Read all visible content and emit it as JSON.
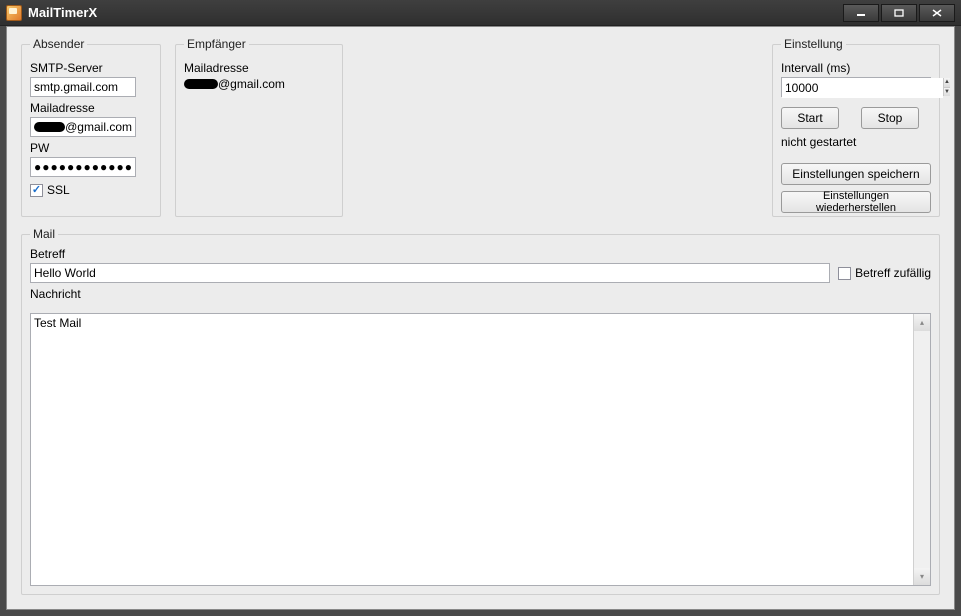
{
  "window": {
    "title": "MailTimerX"
  },
  "absender": {
    "legend": "Absender",
    "smtp_label": "SMTP-Server",
    "smtp_value": "smtp.gmail.com",
    "mail_label": "Mailadresse",
    "mail_suffix": "@gmail.com",
    "pw_label": "PW",
    "pw_value": "●●●●●●●●●●●●●",
    "ssl_label": "SSL",
    "ssl_checked": true
  },
  "empfaenger": {
    "legend": "Empfänger",
    "mail_label": "Mailadresse",
    "mail_suffix": "@gmail.com"
  },
  "einstellung": {
    "legend": "Einstellung",
    "interval_label": "Intervall (ms)",
    "interval_value": "10000",
    "start_label": "Start",
    "stop_label": "Stop",
    "status_text": "nicht gestartet",
    "save_label": "Einstellungen speichern",
    "restore_label": "Einstellungen wiederherstellen"
  },
  "mail": {
    "legend": "Mail",
    "subject_label": "Betreff",
    "subject_value": "Hello World",
    "random_subject_label": "Betreff zufällig",
    "random_subject_checked": false,
    "message_label": "Nachricht",
    "message_value": "Test Mail"
  }
}
